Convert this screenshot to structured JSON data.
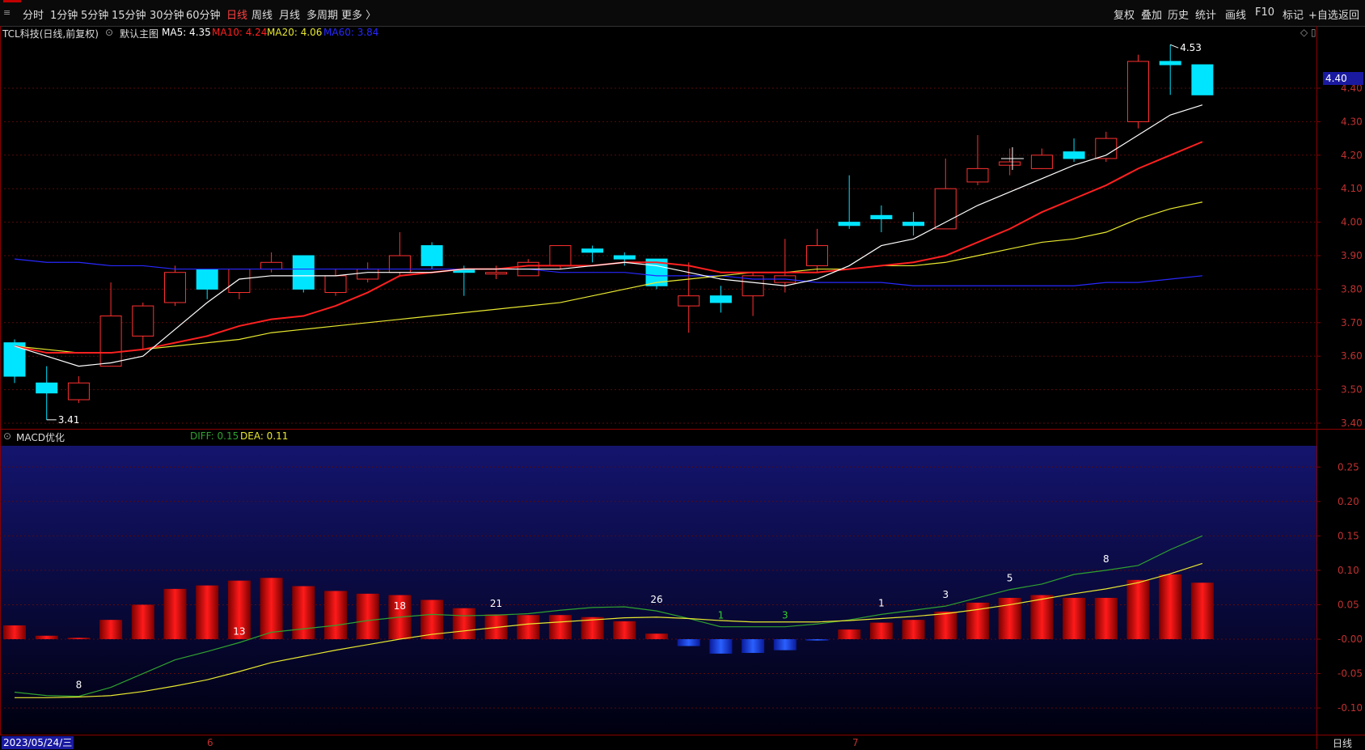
{
  "timeframes": [
    "分时",
    "1分钟",
    "5分钟",
    "15分钟",
    "30分钟",
    "60分钟",
    "日线",
    "周线",
    "月线",
    "多周期",
    "更多 〉"
  ],
  "active_timeframe": "日线",
  "tools": [
    "复权",
    "叠加",
    "历史",
    "统计",
    "画线",
    "F10",
    "标记",
    "+自选",
    "返回"
  ],
  "info": {
    "title": "TCL科技(日线,前复权)",
    "main_chart": "默认主图",
    "ma5": "MA5: 4.35",
    "ma10": "MA10: 4.24",
    "ma20": "MA20: 4.06",
    "ma60": "MA60: 3.84"
  },
  "macd_info": {
    "name": "MACD优化",
    "diff": "DIFF: 0.15",
    "dea": "DEA: 0.11"
  },
  "current_price": "4.40",
  "date": "2023/05/24/三",
  "month_marks": [
    "6",
    "7"
  ],
  "period_label": "日线",
  "high_label": "4.53",
  "low_label": "3.41",
  "colors": {
    "up": "#ff3030",
    "down": "#00e5ff",
    "ma5": "#ffffff",
    "ma10": "#ff2020",
    "ma20": "#e8e830",
    "ma60": "#2828ff",
    "diff": "#2fa12f",
    "dea": "#e8e830"
  },
  "chart_data": [
    {
      "type": "candlestick",
      "title": "TCL科技(日线,前复权)",
      "yticks": [
        "4.40",
        "4.30",
        "4.20",
        "4.10",
        "4.00",
        "3.90",
        "3.80",
        "3.70",
        "3.60",
        "3.50",
        "3.40"
      ],
      "candles": [
        {
          "o": 3.64,
          "c": 3.54,
          "h": 3.65,
          "l": 3.52
        },
        {
          "o": 3.52,
          "c": 3.49,
          "h": 3.57,
          "l": 3.41
        },
        {
          "o": 3.47,
          "c": 3.52,
          "h": 3.54,
          "l": 3.46
        },
        {
          "o": 3.57,
          "c": 3.72,
          "h": 3.82,
          "l": 3.57
        },
        {
          "o": 3.66,
          "c": 3.75,
          "h": 3.76,
          "l": 3.62
        },
        {
          "o": 3.76,
          "c": 3.85,
          "h": 3.87,
          "l": 3.75
        },
        {
          "o": 3.86,
          "c": 3.8,
          "h": 3.86,
          "l": 3.77
        },
        {
          "o": 3.79,
          "c": 3.86,
          "h": 3.86,
          "l": 3.77
        },
        {
          "o": 3.86,
          "c": 3.88,
          "h": 3.91,
          "l": 3.85
        },
        {
          "o": 3.9,
          "c": 3.8,
          "h": 3.9,
          "l": 3.79
        },
        {
          "o": 3.79,
          "c": 3.84,
          "h": 3.86,
          "l": 3.78
        },
        {
          "o": 3.83,
          "c": 3.86,
          "h": 3.88,
          "l": 3.82
        },
        {
          "o": 3.85,
          "c": 3.9,
          "h": 3.97,
          "l": 3.84
        },
        {
          "o": 3.93,
          "c": 3.87,
          "h": 3.94,
          "l": 3.86
        },
        {
          "o": 3.86,
          "c": 3.85,
          "h": 3.87,
          "l": 3.78
        },
        {
          "o": 3.85,
          "c": 3.85,
          "h": 3.87,
          "l": 3.83
        },
        {
          "o": 3.84,
          "c": 3.88,
          "h": 3.89,
          "l": 3.84
        },
        {
          "o": 3.87,
          "c": 3.93,
          "h": 3.93,
          "l": 3.86
        },
        {
          "o": 3.92,
          "c": 3.91,
          "h": 3.93,
          "l": 3.88
        },
        {
          "o": 3.9,
          "c": 3.89,
          "h": 3.91,
          "l": 3.87
        },
        {
          "o": 3.89,
          "c": 3.81,
          "h": 3.89,
          "l": 3.8
        },
        {
          "o": 3.75,
          "c": 3.78,
          "h": 3.88,
          "l": 3.67
        },
        {
          "o": 3.78,
          "c": 3.76,
          "h": 3.81,
          "l": 3.73
        },
        {
          "o": 3.78,
          "c": 3.84,
          "h": 3.85,
          "l": 3.72
        },
        {
          "o": 3.82,
          "c": 3.84,
          "h": 3.95,
          "l": 3.79
        },
        {
          "o": 3.87,
          "c": 3.93,
          "h": 3.98,
          "l": 3.85
        },
        {
          "o": 4.0,
          "c": 3.99,
          "h": 4.14,
          "l": 3.98
        },
        {
          "o": 4.02,
          "c": 4.01,
          "h": 4.05,
          "l": 3.97
        },
        {
          "o": 4.0,
          "c": 3.99,
          "h": 4.03,
          "l": 3.96
        },
        {
          "o": 3.98,
          "c": 4.1,
          "h": 4.19,
          "l": 3.98
        },
        {
          "o": 4.12,
          "c": 4.16,
          "h": 4.26,
          "l": 4.11
        },
        {
          "o": 4.17,
          "c": 4.18,
          "h": 4.22,
          "l": 4.14
        },
        {
          "o": 4.16,
          "c": 4.2,
          "h": 4.22,
          "l": 4.16
        },
        {
          "o": 4.21,
          "c": 4.19,
          "h": 4.25,
          "l": 4.18
        },
        {
          "o": 4.19,
          "c": 4.25,
          "h": 4.27,
          "l": 4.18
        },
        {
          "o": 4.3,
          "c": 4.48,
          "h": 4.5,
          "l": 4.28
        },
        {
          "o": 4.48,
          "c": 4.47,
          "h": 4.53,
          "l": 4.38
        },
        {
          "o": 4.47,
          "c": 4.38,
          "h": 4.47,
          "l": 4.38
        }
      ],
      "ma5": [
        3.63,
        3.6,
        3.57,
        3.58,
        3.6,
        3.68,
        3.76,
        3.83,
        3.84,
        3.84,
        3.84,
        3.85,
        3.85,
        3.85,
        3.86,
        3.86,
        3.86,
        3.86,
        3.87,
        3.88,
        3.87,
        3.85,
        3.83,
        3.82,
        3.81,
        3.83,
        3.87,
        3.93,
        3.95,
        4.0,
        4.05,
        4.09,
        4.13,
        4.17,
        4.2,
        4.26,
        4.32,
        4.35
      ],
      "ma10": [
        3.63,
        3.61,
        3.61,
        3.61,
        3.62,
        3.64,
        3.66,
        3.69,
        3.71,
        3.72,
        3.75,
        3.79,
        3.84,
        3.85,
        3.86,
        3.86,
        3.87,
        3.87,
        3.87,
        3.88,
        3.88,
        3.87,
        3.85,
        3.85,
        3.85,
        3.85,
        3.86,
        3.87,
        3.88,
        3.9,
        3.94,
        3.98,
        4.03,
        4.07,
        4.11,
        4.16,
        4.2,
        4.24
      ],
      "ma20": [
        3.63,
        3.62,
        3.61,
        3.61,
        3.62,
        3.63,
        3.64,
        3.65,
        3.67,
        3.68,
        3.69,
        3.7,
        3.71,
        3.72,
        3.73,
        3.74,
        3.75,
        3.76,
        3.78,
        3.8,
        3.82,
        3.83,
        3.84,
        3.85,
        3.85,
        3.86,
        3.86,
        3.87,
        3.87,
        3.88,
        3.9,
        3.92,
        3.94,
        3.95,
        3.97,
        4.01,
        4.04,
        4.06
      ],
      "ma60": [
        3.89,
        3.88,
        3.88,
        3.87,
        3.87,
        3.86,
        3.86,
        3.86,
        3.86,
        3.86,
        3.86,
        3.86,
        3.86,
        3.86,
        3.86,
        3.86,
        3.86,
        3.85,
        3.85,
        3.85,
        3.84,
        3.84,
        3.84,
        3.83,
        3.83,
        3.82,
        3.82,
        3.82,
        3.81,
        3.81,
        3.81,
        3.81,
        3.81,
        3.81,
        3.82,
        3.82,
        3.83,
        3.84
      ]
    },
    {
      "type": "bar",
      "title": "MACD优化",
      "yticks": [
        "0.25",
        "0.20",
        "0.15",
        "0.10",
        "0.05",
        "-0.00",
        "-0.05",
        "-0.10"
      ],
      "macd": [
        0.02,
        0.005,
        0.002,
        0.028,
        0.05,
        0.073,
        0.078,
        0.085,
        0.089,
        0.077,
        0.07,
        0.066,
        0.064,
        0.057,
        0.045,
        0.036,
        0.035,
        0.035,
        0.032,
        0.026,
        0.008,
        -0.01,
        -0.021,
        -0.02,
        -0.016,
        -0.002,
        0.014,
        0.024,
        0.028,
        0.04,
        0.053,
        0.06,
        0.064,
        0.06,
        0.06,
        0.086,
        0.094,
        0.082
      ],
      "diff": [
        -0.077,
        -0.082,
        -0.083,
        -0.07,
        -0.05,
        -0.03,
        -0.018,
        -0.005,
        0.01,
        0.015,
        0.02,
        0.027,
        0.032,
        0.036,
        0.034,
        0.035,
        0.037,
        0.042,
        0.046,
        0.047,
        0.041,
        0.03,
        0.018,
        0.018,
        0.018,
        0.022,
        0.028,
        0.036,
        0.042,
        0.048,
        0.06,
        0.072,
        0.08,
        0.094,
        0.1,
        0.107,
        0.13,
        0.15
      ],
      "dea": [
        -0.085,
        -0.085,
        -0.084,
        -0.082,
        -0.076,
        -0.068,
        -0.059,
        -0.047,
        -0.034,
        -0.025,
        -0.016,
        -0.008,
        0.0,
        0.007,
        0.012,
        0.017,
        0.022,
        0.025,
        0.028,
        0.031,
        0.032,
        0.03,
        0.027,
        0.025,
        0.025,
        0.025,
        0.027,
        0.03,
        0.033,
        0.037,
        0.043,
        0.05,
        0.058,
        0.066,
        0.073,
        0.082,
        0.095,
        0.11
      ],
      "annotations": [
        {
          "i": 2,
          "text": "8",
          "color": "white"
        },
        {
          "i": 7,
          "text": "13",
          "color": "white"
        },
        {
          "i": 12,
          "text": "18",
          "color": "white"
        },
        {
          "i": 15,
          "text": "21",
          "color": "white"
        },
        {
          "i": 20,
          "text": "26",
          "color": "white"
        },
        {
          "i": 22,
          "text": "1",
          "color": "green"
        },
        {
          "i": 24,
          "text": "3",
          "color": "green"
        },
        {
          "i": 27,
          "text": "1",
          "color": "white"
        },
        {
          "i": 29,
          "text": "3",
          "color": "white"
        },
        {
          "i": 31,
          "text": "5",
          "color": "white"
        },
        {
          "i": 34,
          "text": "8",
          "color": "white"
        }
      ]
    }
  ]
}
